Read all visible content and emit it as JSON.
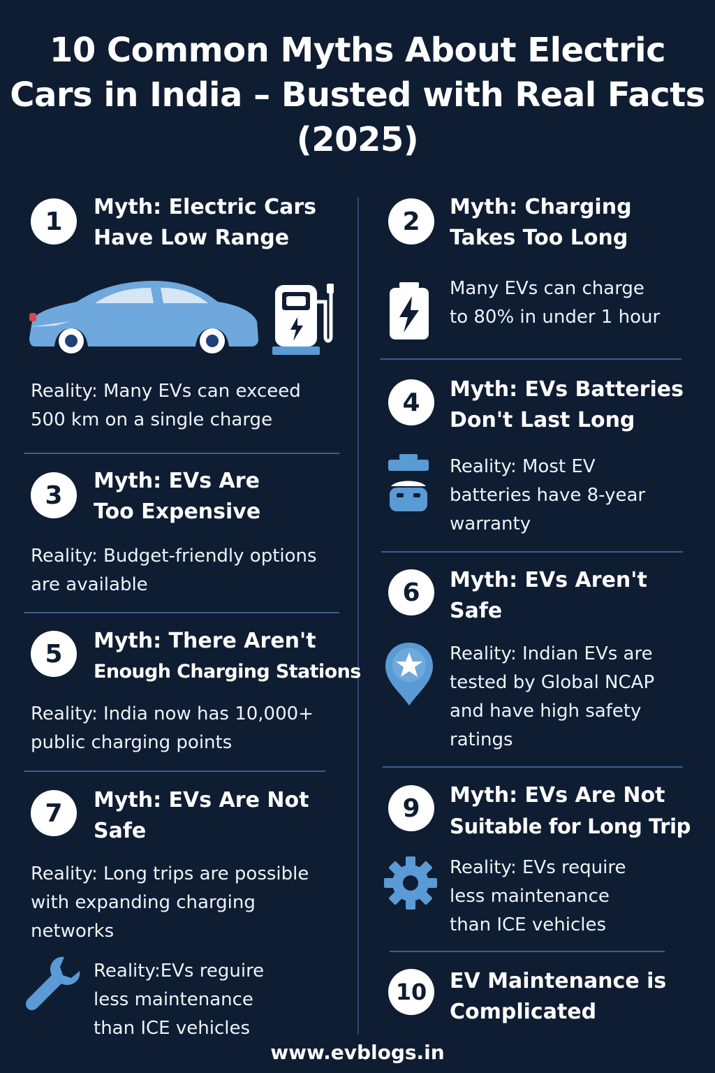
{
  "title": {
    "line1": "10 Common Myths About Electric",
    "line2": "Cars in India – Busted with Real Facts",
    "line3": "(2025)"
  },
  "myths": {
    "m1": {
      "number": "1",
      "line1": "Myth: Electric Cars",
      "line2": "Have Low Range",
      "reality1": "Reality: Many EVs can exceed",
      "reality2": "500 km on a single charge"
    },
    "m2": {
      "number": "2",
      "line1": "Myth: Charging",
      "line2": "Takes Too Long",
      "reality1": "Many EVs can charge",
      "reality2": "to 80% in under 1 hour"
    },
    "m3": {
      "number": "3",
      "line1": "Myth: EVs Are",
      "line2": "Too Expensive",
      "reality1": "Reality: Budget-friendly options",
      "reality2": "are available"
    },
    "m4": {
      "number": "4",
      "line1": "Myth: EVs Batteries",
      "line2": "Don't Last Long",
      "reality1": "Reality: Most EV",
      "reality2": "batteries have 8-year",
      "reality3": "warranty"
    },
    "m5": {
      "number": "5",
      "line1": "Myth: There Aren't",
      "line2": "Enough Charging Stations",
      "reality1": "Reality: India now has 10,000+",
      "reality2": "public charging points"
    },
    "m6": {
      "number": "6",
      "line1": "Myth: EVs Aren't",
      "line2": "Safe",
      "reality1": "Reality: Indian EVs are",
      "reality2": "tested by Global NCAP",
      "reality3": "and have high safety",
      "reality4": "ratings"
    },
    "m7": {
      "number": "7",
      "line1": "Myth: EVs Are Not",
      "line2": "Safe",
      "reality1": "Reality: Long trips are possible",
      "reality2": "with expanding charging",
      "reality3": "networks",
      "extra1": "Reality:EVs reguire",
      "extra2": "less maintenance",
      "extra3": "than ICE vehicles"
    },
    "m9": {
      "number": "9",
      "line1": "Myth: EVs Are Not",
      "line2": "Suitable for Long Trip",
      "reality1": "Reality: EVs require",
      "reality2": "less maintenance",
      "reality3": "than ICE vehicles"
    },
    "m10": {
      "number": "10",
      "line1": "EV Maintenance is",
      "line2": "Complicated"
    }
  },
  "footer": "www.evblogs.in",
  "colors": {
    "background": "#0f1d33",
    "accent": "#5b9bd5",
    "text": "#ffffff"
  },
  "icons": [
    "car-icon",
    "charging-station-icon",
    "battery-charge-icon",
    "battery-pack-icon",
    "shield-star-icon",
    "gear-icon",
    "wrench-icon"
  ]
}
